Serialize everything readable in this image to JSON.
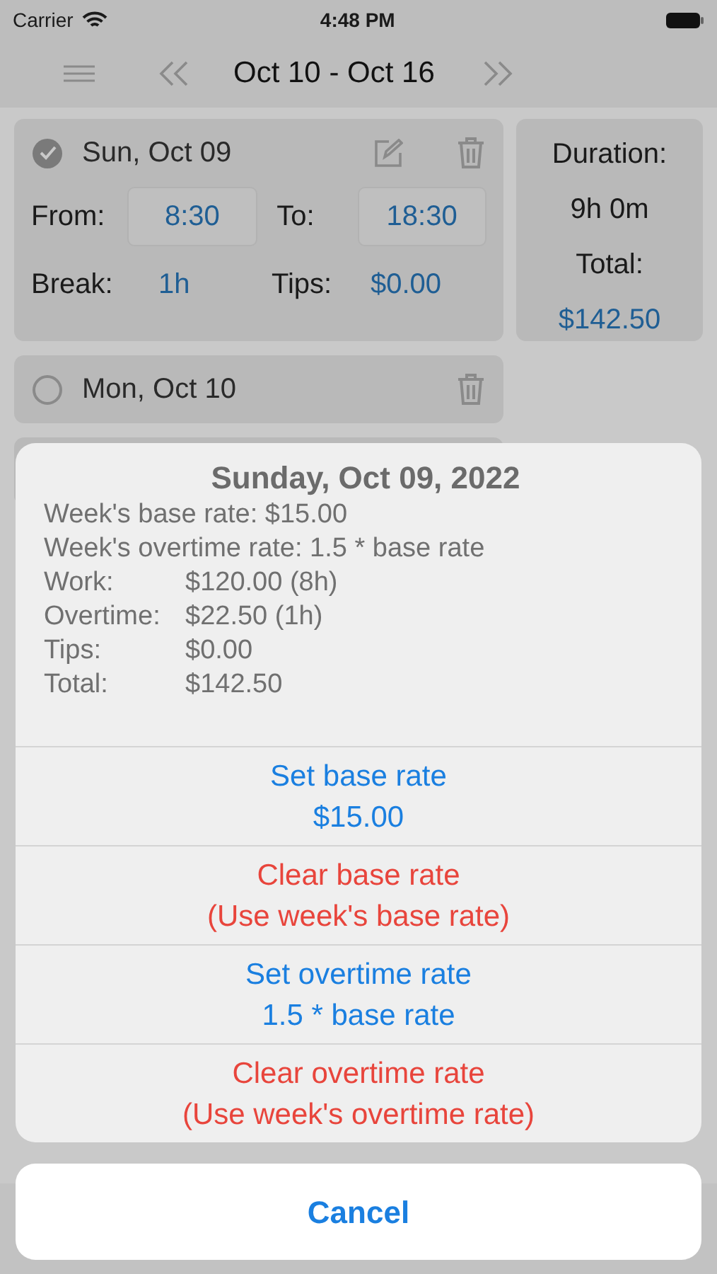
{
  "status_bar": {
    "carrier": "Carrier",
    "time": "4:48 PM"
  },
  "nav": {
    "title": "Oct 10 - Oct 16"
  },
  "days": [
    {
      "kind": "expanded",
      "date": "Sun, Oct 09",
      "checked": true,
      "from_label": "From:",
      "from": "8:30",
      "to_label": "To:",
      "to": "18:30",
      "break_label": "Break:",
      "break": "1h",
      "tips_label": "Tips:",
      "tips": "$0.00"
    },
    {
      "kind": "collapsed",
      "date": "Mon, Oct 10",
      "checked": false
    }
  ],
  "summary": {
    "duration_label": "Duration:",
    "duration": "9h 0m",
    "total_label": "Total:",
    "total": "$142.50"
  },
  "action_sheet": {
    "title": "Sunday, Oct 09, 2022",
    "lines": [
      {
        "kind": "text",
        "text": "Week's base rate: $15.00"
      },
      {
        "kind": "text",
        "text": "Week's overtime rate: 1.5 * base rate"
      },
      {
        "kind": "pair",
        "label": "Work:",
        "value": "$120.00 (8h)"
      },
      {
        "kind": "pair",
        "label": "Overtime:",
        "value": "$22.50 (1h)"
      },
      {
        "kind": "pair",
        "label": "Tips:",
        "value": "$0.00"
      },
      {
        "kind": "pair",
        "label": "Total:",
        "value": "$142.50"
      }
    ],
    "actions": [
      {
        "kind": "default",
        "lines": [
          "Set base rate",
          "$15.00"
        ]
      },
      {
        "kind": "destructive",
        "lines": [
          "Clear base rate",
          "(Use week's base rate)"
        ]
      },
      {
        "kind": "default",
        "lines": [
          "Set overtime rate",
          "1.5 * base rate"
        ]
      },
      {
        "kind": "destructive",
        "lines": [
          "Clear overtime rate",
          "(Use week's overtime rate)"
        ]
      }
    ],
    "cancel": "Cancel"
  }
}
